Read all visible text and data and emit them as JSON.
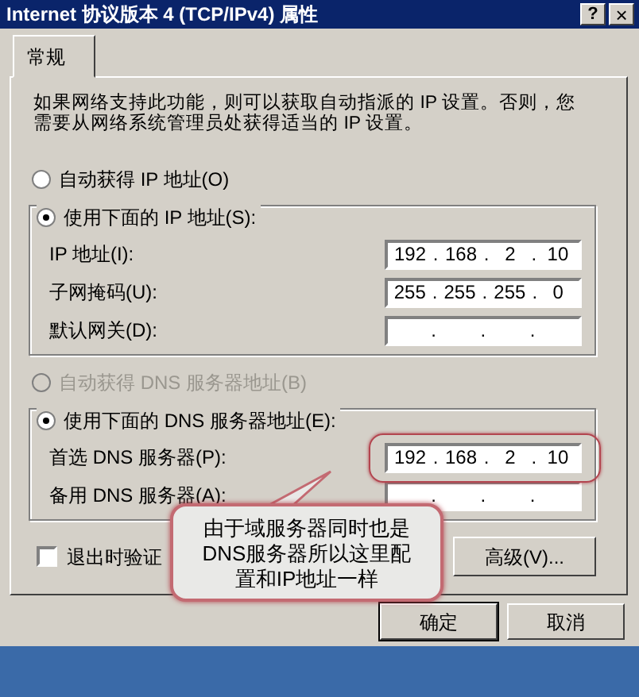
{
  "window": {
    "title": "Internet 协议版本 4 (TCP/IPv4) 属性",
    "buttons": [
      {
        "kind": "help",
        "label": "?"
      },
      {
        "kind": "close",
        "label": "×"
      }
    ]
  },
  "tabs": [
    {
      "label": "常规",
      "selected": true
    }
  ],
  "description": "如果网络支持此功能，则可以获取自动指派的 IP 设置。否则，您需要从网络系统管理员处获得适当的 IP 设置。",
  "separator": ".",
  "ip_options": [
    {
      "label": "自动获得 IP 地址(O)",
      "selected": false,
      "disabled": false
    },
    {
      "label": "使用下面的 IP 地址(S):",
      "selected": true,
      "disabled": false
    }
  ],
  "ip_fields": [
    {
      "label": "IP 地址(I):",
      "segments": [
        "192",
        "168",
        "2",
        "10"
      ]
    },
    {
      "label": "子网掩码(U):",
      "segments": [
        "255",
        "255",
        "255",
        "0"
      ]
    },
    {
      "label": "默认网关(D):"
    }
  ],
  "dns_options": [
    {
      "label": "自动获得 DNS 服务器地址(B)",
      "selected": false,
      "disabled": true
    },
    {
      "label": "使用下面的 DNS 服务器地址(E):",
      "selected": true,
      "disabled": false
    }
  ],
  "dns_fields": [
    {
      "label": "首选 DNS 服务器(P):",
      "segments": [
        "192",
        "168",
        "2",
        "10"
      ],
      "highlighted": true
    },
    {
      "label": "备用 DNS 服务器(A):",
      "highlighted": false
    }
  ],
  "validate_checkbox": {
    "label": "退出时验证",
    "checked": false
  },
  "advanced_button": "高级(V)...",
  "buttons": [
    {
      "label": "确定",
      "default": true
    },
    {
      "label": "取消",
      "default": false
    }
  ],
  "callout": "由于域服务器同时也是DNS服务器所以这里配置和IP地址一样"
}
